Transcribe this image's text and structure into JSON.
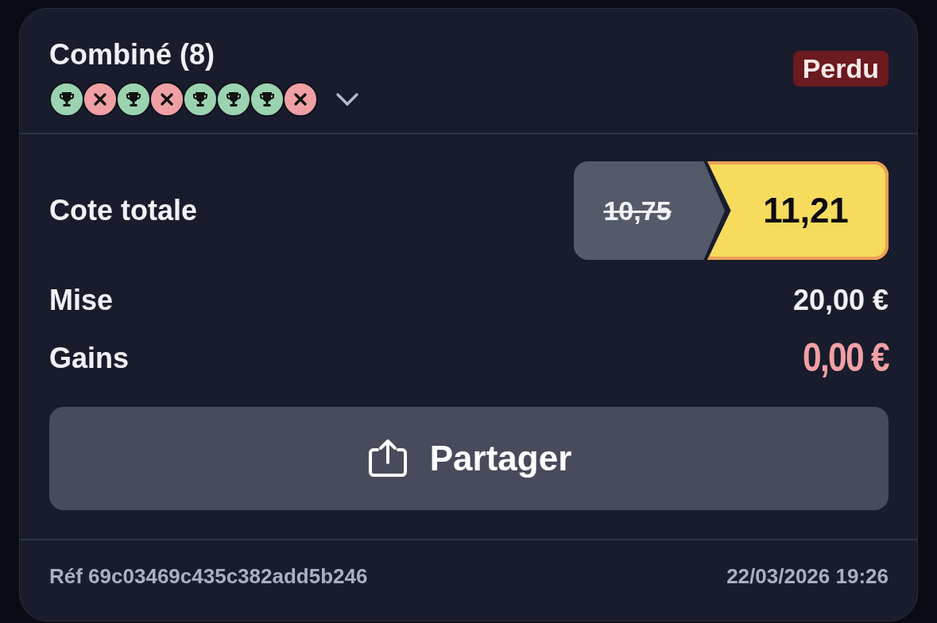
{
  "bet": {
    "title": "Combiné (8)",
    "status": "Perdu",
    "legs": [
      {
        "kind": "won"
      },
      {
        "kind": "lost"
      },
      {
        "kind": "won"
      },
      {
        "kind": "lost"
      },
      {
        "kind": "won"
      },
      {
        "kind": "won"
      },
      {
        "kind": "won"
      },
      {
        "kind": "lost"
      }
    ],
    "expanded": false
  },
  "odds": {
    "label": "Cote totale",
    "old_value": "10,75",
    "value": "11,21"
  },
  "stake": {
    "label": "Mise",
    "value": "20,00 €"
  },
  "winnings": {
    "label": "Gains",
    "value": "0,00 €"
  },
  "share_button": "Partager",
  "footer": {
    "reference": "Réf 69c03469c435c382add5b246",
    "date": "22/03/2026 19:26"
  }
}
